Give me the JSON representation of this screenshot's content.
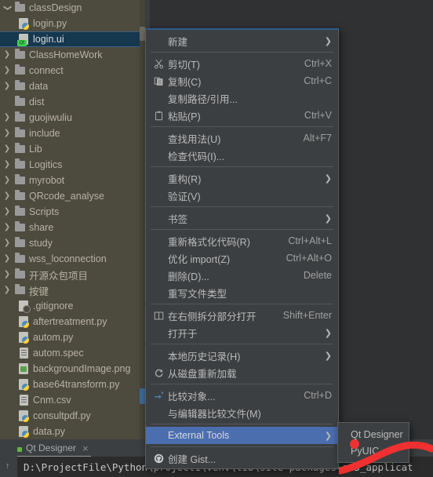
{
  "sidebar": {
    "name": "project-tree",
    "items": [
      {
        "label": "classDesign",
        "icon": "folder-icon",
        "indent": 0,
        "arrow": "open",
        "selected": false
      },
      {
        "label": "login.py",
        "icon": "python-file-icon",
        "indent": 1,
        "arrow": "none",
        "selected": false
      },
      {
        "label": "login.ui",
        "icon": "qt-ui-file-icon",
        "indent": 1,
        "arrow": "none",
        "selected": true
      },
      {
        "label": "ClassHomeWork",
        "icon": "folder-icon",
        "indent": 0,
        "arrow": "closed",
        "selected": false
      },
      {
        "label": "connect",
        "icon": "folder-icon",
        "indent": 0,
        "arrow": "closed",
        "selected": false
      },
      {
        "label": "data",
        "icon": "folder-icon",
        "indent": 0,
        "arrow": "closed",
        "selected": false
      },
      {
        "label": "dist",
        "icon": "folder-icon",
        "indent": 0,
        "arrow": "none",
        "selected": false
      },
      {
        "label": "guojiwuliu",
        "icon": "folder-icon",
        "indent": 0,
        "arrow": "closed",
        "selected": false
      },
      {
        "label": "include",
        "icon": "folder-icon",
        "indent": 0,
        "arrow": "closed",
        "selected": false
      },
      {
        "label": "Lib",
        "icon": "folder-icon",
        "indent": 0,
        "arrow": "closed",
        "selected": false
      },
      {
        "label": "Logitics",
        "icon": "folder-icon",
        "indent": 0,
        "arrow": "closed",
        "selected": false
      },
      {
        "label": "myrobot",
        "icon": "folder-icon",
        "indent": 0,
        "arrow": "closed",
        "selected": false
      },
      {
        "label": "QRcode_analyse",
        "icon": "folder-icon",
        "indent": 0,
        "arrow": "closed",
        "selected": false
      },
      {
        "label": "Scripts",
        "icon": "folder-icon",
        "indent": 0,
        "arrow": "closed",
        "selected": false
      },
      {
        "label": "share",
        "icon": "folder-icon",
        "indent": 0,
        "arrow": "closed",
        "selected": false
      },
      {
        "label": "study",
        "icon": "folder-icon",
        "indent": 0,
        "arrow": "closed",
        "selected": false
      },
      {
        "label": "wss_loconnection",
        "icon": "folder-icon",
        "indent": 0,
        "arrow": "closed",
        "selected": false
      },
      {
        "label": "开源众包项目",
        "icon": "folder-icon",
        "indent": 0,
        "arrow": "closed",
        "selected": false
      },
      {
        "label": "按键",
        "icon": "folder-icon",
        "indent": 0,
        "arrow": "closed",
        "selected": false
      },
      {
        "label": ".gitignore",
        "icon": "gitignore-file-icon",
        "indent": 1,
        "arrow": "none",
        "selected": false
      },
      {
        "label": "aftertreatment.py",
        "icon": "python-file-icon",
        "indent": 1,
        "arrow": "none",
        "selected": false
      },
      {
        "label": "autom.py",
        "icon": "python-file-icon",
        "indent": 1,
        "arrow": "none",
        "selected": false
      },
      {
        "label": "autom.spec",
        "icon": "text-file-icon",
        "indent": 1,
        "arrow": "none",
        "selected": false
      },
      {
        "label": "backgroundImage.png",
        "icon": "image-file-icon",
        "indent": 1,
        "arrow": "none",
        "selected": false
      },
      {
        "label": "base64transform.py",
        "icon": "python-file-icon",
        "indent": 1,
        "arrow": "none",
        "selected": false
      },
      {
        "label": "Cnm.csv",
        "icon": "text-file-icon",
        "indent": 1,
        "arrow": "none",
        "selected": false
      },
      {
        "label": "consultpdf.py",
        "icon": "python-file-icon",
        "indent": 1,
        "arrow": "none",
        "selected": false
      },
      {
        "label": "data.py",
        "icon": "python-file-icon",
        "indent": 1,
        "arrow": "none",
        "selected": false
      }
    ]
  },
  "context_menu": {
    "name": "file-context-menu",
    "items": [
      {
        "type": "item",
        "label": "新建",
        "shortcut": "",
        "icon": "",
        "arrow": true,
        "highlight": false
      },
      {
        "type": "sep"
      },
      {
        "type": "item",
        "label": "剪切(T)",
        "shortcut": "Ctrl+X",
        "icon": "cut-icon",
        "arrow": false,
        "highlight": false,
        "mnemonic": "T"
      },
      {
        "type": "item",
        "label": "复制(C)",
        "shortcut": "Ctrl+C",
        "icon": "copy-icon",
        "arrow": false,
        "highlight": false,
        "mnemonic": "C"
      },
      {
        "type": "item",
        "label": "复制路径/引用...",
        "shortcut": "",
        "icon": "",
        "arrow": false,
        "highlight": false
      },
      {
        "type": "item",
        "label": "粘贴(P)",
        "shortcut": "Ctrl+V",
        "icon": "paste-icon",
        "arrow": false,
        "highlight": false,
        "mnemonic": "P"
      },
      {
        "type": "sep"
      },
      {
        "type": "item",
        "label": "查找用法(U)",
        "shortcut": "Alt+F7",
        "icon": "",
        "arrow": false,
        "highlight": false,
        "mnemonic": "U"
      },
      {
        "type": "item",
        "label": "检查代码(I)...",
        "shortcut": "",
        "icon": "",
        "arrow": false,
        "highlight": false,
        "mnemonic": "I"
      },
      {
        "type": "sep"
      },
      {
        "type": "item",
        "label": "重构(R)",
        "shortcut": "",
        "icon": "",
        "arrow": true,
        "highlight": false,
        "mnemonic": "R"
      },
      {
        "type": "item",
        "label": "验证(V)",
        "shortcut": "",
        "icon": "",
        "arrow": false,
        "highlight": false,
        "mnemonic": "V"
      },
      {
        "type": "sep"
      },
      {
        "type": "item",
        "label": "书签",
        "shortcut": "",
        "icon": "",
        "arrow": true,
        "highlight": false
      },
      {
        "type": "sep"
      },
      {
        "type": "item",
        "label": "重新格式化代码(R)",
        "shortcut": "Ctrl+Alt+L",
        "icon": "",
        "arrow": false,
        "highlight": false,
        "mnemonic": "R"
      },
      {
        "type": "item",
        "label": "优化 import(Z)",
        "shortcut": "Ctrl+Alt+O",
        "icon": "",
        "arrow": false,
        "highlight": false,
        "mnemonic": "Z"
      },
      {
        "type": "item",
        "label": "删除(D)...",
        "shortcut": "Delete",
        "icon": "",
        "arrow": false,
        "highlight": false,
        "mnemonic": "D"
      },
      {
        "type": "item",
        "label": "重写文件类型",
        "shortcut": "",
        "icon": "",
        "arrow": false,
        "highlight": false
      },
      {
        "type": "sep"
      },
      {
        "type": "item",
        "label": "在右侧拆分部分打开",
        "shortcut": "Shift+Enter",
        "icon": "split-right-icon",
        "arrow": false,
        "highlight": false
      },
      {
        "type": "item",
        "label": "打开于",
        "shortcut": "",
        "icon": "",
        "arrow": true,
        "highlight": false
      },
      {
        "type": "sep"
      },
      {
        "type": "item",
        "label": "本地历史记录(H)",
        "shortcut": "",
        "icon": "",
        "arrow": true,
        "highlight": false,
        "mnemonic": "H"
      },
      {
        "type": "item",
        "label": "从磁盘重新加载",
        "shortcut": "",
        "icon": "refresh-icon",
        "arrow": false,
        "highlight": false
      },
      {
        "type": "sep"
      },
      {
        "type": "item",
        "label": "比较对象...",
        "shortcut": "Ctrl+D",
        "icon": "compare-icon",
        "arrow": false,
        "highlight": false
      },
      {
        "type": "item",
        "label": "与编辑器比较文件(M)",
        "shortcut": "",
        "icon": "",
        "arrow": false,
        "highlight": false,
        "mnemonic": "M"
      },
      {
        "type": "sep"
      },
      {
        "type": "item",
        "label": "External Tools",
        "shortcut": "",
        "icon": "",
        "arrow": true,
        "highlight": true
      },
      {
        "type": "sep"
      },
      {
        "type": "item",
        "label": "创建 Gist...",
        "shortcut": "",
        "icon": "github-icon",
        "arrow": false,
        "highlight": false
      }
    ]
  },
  "submenu": {
    "name": "external-tools-submenu",
    "items": [
      {
        "label": "Qt Designer"
      },
      {
        "label": "PyUIC"
      }
    ]
  },
  "bottom_panel": {
    "tab_label": "Qt Designer",
    "tab_close": "×",
    "console_text": "D:\\ProjectFile\\Python\\project1\\venv\\lib\\site-packages\\qt5_applicat"
  },
  "colors": {
    "sidebar_bg": "#4d4a3e",
    "menu_bg": "#3c3f41",
    "menu_highlight": "#4b6eaf",
    "tree_selected": "#16384f",
    "editor_bg": "#2f3133",
    "console_bg": "#2b2b2b",
    "annotation_red": "#f03030",
    "run_green": "#62b543"
  }
}
